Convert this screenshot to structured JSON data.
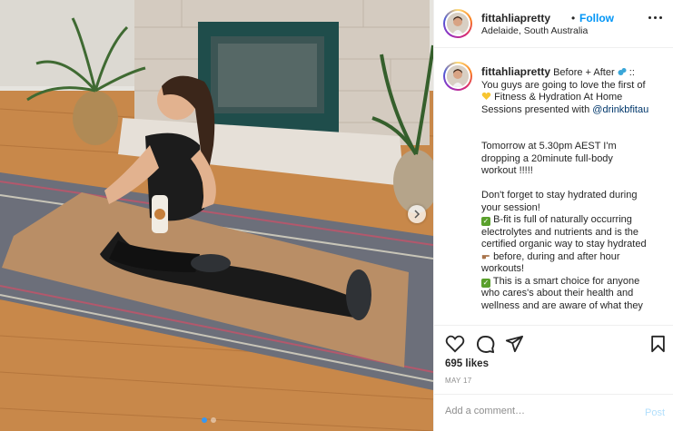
{
  "post": {
    "username": "fittahliapretty",
    "bullet": "•",
    "follow_label": "Follow",
    "location": "Adelaide, South Australia"
  },
  "caption": {
    "username": "fittahliapretty",
    "lines": {
      "l1": "Before + After",
      "l1_suffix": "::",
      "l2": "You guys are going to love the first of",
      "l3": "Fitness & Hydration At Home",
      "l4a": "Sessions presented with ",
      "l4_mention": "@drinkbfitau",
      "l6": "Tomorrow at 5.30pm AEST I'm",
      "l7": "dropping a 20minute full-body",
      "l8": "workout !!!!!",
      "l10": "Don't forget to stay hydrated during",
      "l11": "your session!",
      "l12": "B-fit is full of naturally occurring",
      "l13": "electrolytes and nutrients and is the",
      "l14": "certified organic way to stay hydrated",
      "l15": "before, during and after hour",
      "l16": "workouts!",
      "l17": "This is a smart choice for anyone",
      "l18": "who cares's about their health and",
      "l19": "wellness and are aware of what they"
    }
  },
  "likes": "695 likes",
  "date": "MAY 17",
  "comment_box": {
    "placeholder": "Add a comment…",
    "post_label": "Post"
  },
  "icons": {
    "like": "heart-icon",
    "comment": "comment-icon",
    "share": "paper-plane-icon",
    "save": "bookmark-icon",
    "more": "more-options-icon",
    "next": "chevron-right-icon"
  },
  "colors": {
    "link": "#0095f6",
    "mention": "#00376b",
    "muted": "#8e8e8e",
    "carousel_active": "#3897f0"
  }
}
